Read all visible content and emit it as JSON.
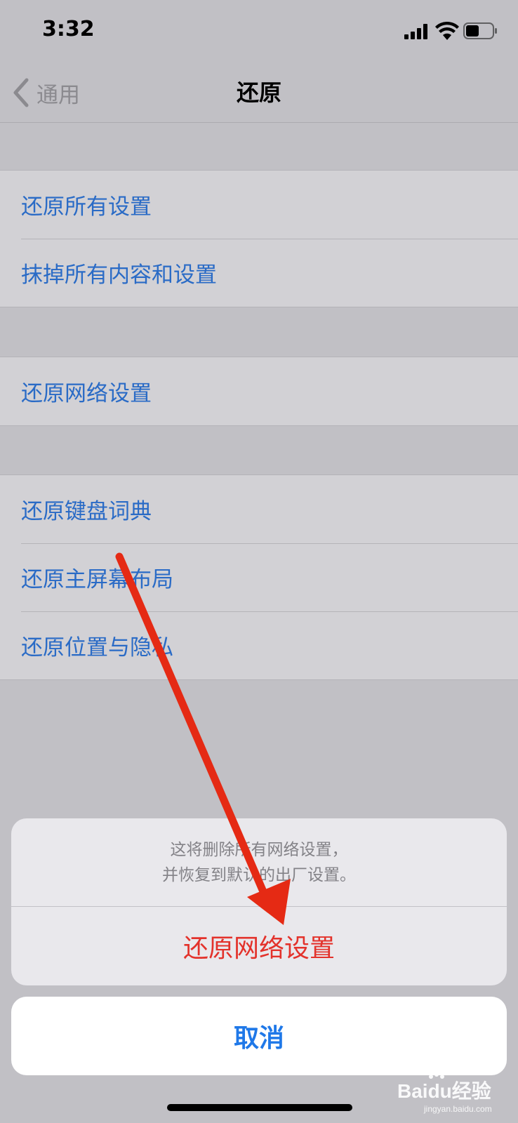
{
  "status_bar": {
    "time": "3:32"
  },
  "nav": {
    "back_label": "通用",
    "title": "还原"
  },
  "groups": [
    {
      "items": [
        {
          "label": "还原所有设置"
        },
        {
          "label": "抹掉所有内容和设置"
        }
      ]
    },
    {
      "items": [
        {
          "label": "还原网络设置"
        }
      ]
    },
    {
      "items": [
        {
          "label": "还原键盘词典"
        },
        {
          "label": "还原主屏幕布局"
        },
        {
          "label": "还原位置与隐私"
        }
      ]
    }
  ],
  "sheet": {
    "message_line1": "这将删除所有网络设置，",
    "message_line2": "并恢复到默认的出厂设置。",
    "destructive_label": "还原网络设置",
    "cancel_label": "取消"
  },
  "watermark": {
    "brand": "Baidu经验",
    "sub": "jingyan.baidu.com"
  },
  "colors": {
    "link_blue": "#2a6bc6",
    "destructive_red": "#e3322b",
    "cancel_blue": "#1f78e8",
    "annotation_arrow": "#e52a14"
  }
}
